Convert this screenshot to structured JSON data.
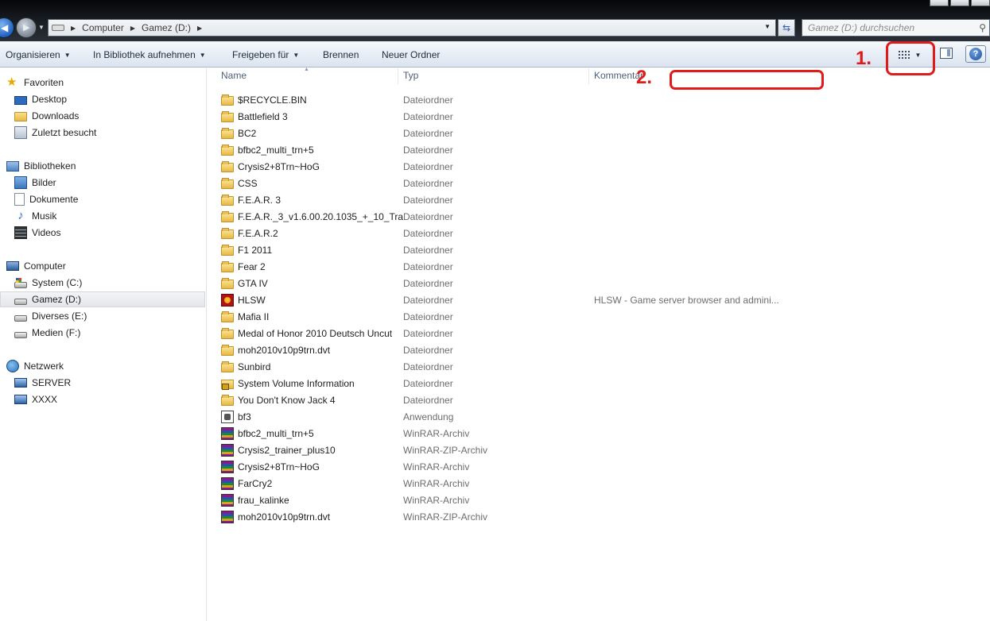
{
  "address": {
    "crumbs": [
      "Computer",
      "Gamez (D:)"
    ]
  },
  "search": {
    "placeholder": "Gamez (D:) durchsuchen"
  },
  "toolbar": {
    "organize": "Organisieren",
    "add_library": "In Bibliothek aufnehmen",
    "share": "Freigeben für",
    "burn": "Brennen",
    "new_folder": "Neuer Ordner"
  },
  "columns": {
    "name": "Name",
    "type": "Typ",
    "comment": "Kommentar"
  },
  "sidebar": {
    "favorites": {
      "label": "Favoriten",
      "items": [
        "Desktop",
        "Downloads",
        "Zuletzt besucht"
      ]
    },
    "libraries": {
      "label": "Bibliotheken",
      "items": [
        "Bilder",
        "Dokumente",
        "Musik",
        "Videos"
      ]
    },
    "computer": {
      "label": "Computer",
      "items": [
        "System (C:)",
        "Gamez (D:)",
        "Diverses (E:)",
        "Medien (F:)"
      ],
      "selected": "Gamez (D:)"
    },
    "network": {
      "label": "Netzwerk",
      "items": [
        "SERVER",
        "XXXX"
      ]
    }
  },
  "files": [
    {
      "name": "$RECYCLE.BIN",
      "type": "Dateiordner",
      "comment": "",
      "icon": "folder"
    },
    {
      "name": "Battlefield 3",
      "type": "Dateiordner",
      "comment": "",
      "icon": "folder"
    },
    {
      "name": "BC2",
      "type": "Dateiordner",
      "comment": "",
      "icon": "folder"
    },
    {
      "name": "bfbc2_multi_trn+5",
      "type": "Dateiordner",
      "comment": "",
      "icon": "folder"
    },
    {
      "name": "Crysis2+8Trn~HoG",
      "type": "Dateiordner",
      "comment": "",
      "icon": "folder"
    },
    {
      "name": "CSS",
      "type": "Dateiordner",
      "comment": "",
      "icon": "folder"
    },
    {
      "name": "F.E.A.R. 3",
      "type": "Dateiordner",
      "comment": "",
      "icon": "folder"
    },
    {
      "name": "F.E.A.R._3_v1.6.00.20.1035_+_10_Tra...",
      "type": "Dateiordner",
      "comment": "",
      "icon": "folder"
    },
    {
      "name": "F.E.A.R.2",
      "type": "Dateiordner",
      "comment": "",
      "icon": "folder"
    },
    {
      "name": "F1 2011",
      "type": "Dateiordner",
      "comment": "",
      "icon": "folder"
    },
    {
      "name": "Fear 2",
      "type": "Dateiordner",
      "comment": "",
      "icon": "folder"
    },
    {
      "name": "GTA IV",
      "type": "Dateiordner",
      "comment": "",
      "icon": "folder"
    },
    {
      "name": "HLSW",
      "type": "Dateiordner",
      "comment": "HLSW - Game server browser and admini...",
      "icon": "hlsw"
    },
    {
      "name": "Mafia II",
      "type": "Dateiordner",
      "comment": "",
      "icon": "folder"
    },
    {
      "name": "Medal of Honor 2010 Deutsch Uncut",
      "type": "Dateiordner",
      "comment": "",
      "icon": "folder"
    },
    {
      "name": "moh2010v10p9trn.dvt",
      "type": "Dateiordner",
      "comment": "",
      "icon": "folder"
    },
    {
      "name": "Sunbird",
      "type": "Dateiordner",
      "comment": "",
      "icon": "folder"
    },
    {
      "name": "System Volume Information",
      "type": "Dateiordner",
      "comment": "",
      "icon": "locked-folder"
    },
    {
      "name": "You Don't Know Jack 4",
      "type": "Dateiordner",
      "comment": "",
      "icon": "folder"
    },
    {
      "name": "bf3",
      "type": "Anwendung",
      "comment": "",
      "icon": "application"
    },
    {
      "name": "bfbc2_multi_trn+5",
      "type": "WinRAR-Archiv",
      "comment": "",
      "icon": "winrar"
    },
    {
      "name": "Crysis2_trainer_plus10",
      "type": "WinRAR-ZIP-Archiv",
      "comment": "",
      "icon": "winrar"
    },
    {
      "name": "Crysis2+8Trn~HoG",
      "type": "WinRAR-Archiv",
      "comment": "",
      "icon": "winrar"
    },
    {
      "name": "FarCry2",
      "type": "WinRAR-Archiv",
      "comment": "",
      "icon": "winrar"
    },
    {
      "name": "frau_kalinke",
      "type": "WinRAR-Archiv",
      "comment": "",
      "icon": "winrar"
    },
    {
      "name": "moh2010v10p9trn.dvt",
      "type": "WinRAR-ZIP-Archiv",
      "comment": "",
      "icon": "winrar"
    }
  ],
  "annotations": {
    "one": "1.",
    "two": "2.",
    "color": "#e01b1b"
  }
}
